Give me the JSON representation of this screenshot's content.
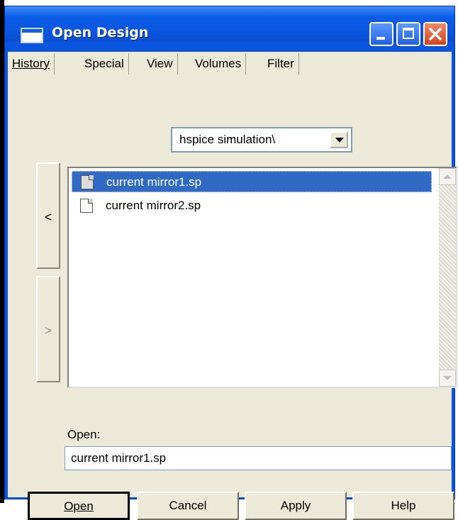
{
  "window": {
    "title": "Open Design",
    "titlebar_color": "#0b5ce8",
    "controls": [
      "minimize-icon",
      "maximize-icon",
      "close-icon"
    ]
  },
  "menu": {
    "items": [
      {
        "label": "History"
      },
      {
        "label": "Special"
      },
      {
        "label": "View"
      },
      {
        "label": "Volumes"
      },
      {
        "label": "Filter"
      }
    ]
  },
  "directory": {
    "selected": "hspice simulation\\"
  },
  "nav": {
    "back": "<",
    "forward": ">"
  },
  "files": [
    {
      "name": "current mirror1.sp",
      "selected": true
    },
    {
      "name": "current mirror2.sp",
      "selected": false
    }
  ],
  "open_field": {
    "label": "Open:",
    "value": "current mirror1.sp"
  },
  "buttons": {
    "open": "Open",
    "cancel": "Cancel",
    "apply": "Apply",
    "help": "Help"
  },
  "colors": {
    "selection": "#316ac5",
    "dialog_bg": "#ece9d8"
  }
}
